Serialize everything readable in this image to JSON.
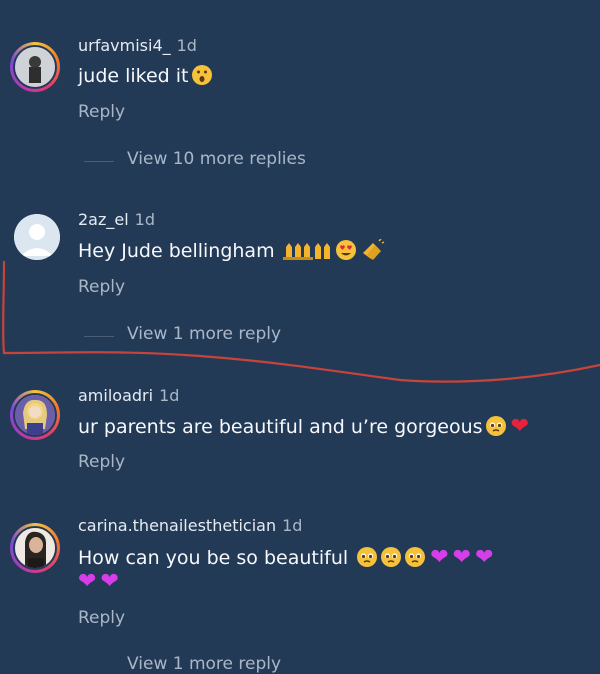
{
  "comments": [
    {
      "username": "urfavmisi4_",
      "time": "1d",
      "text": "jude liked it",
      "reply_label": "Reply",
      "view_replies": "View 10 more replies",
      "emojis": [
        "astonished-face"
      ]
    },
    {
      "username": "2az_el",
      "time": "1d",
      "text": "Hey Jude bellingham",
      "reply_label": "Reply",
      "view_replies": "View 1 more reply",
      "emojis": [
        "raising-hands",
        "raising-hands",
        "heart-eyes-face",
        "clapping-hands"
      ]
    },
    {
      "username": "amiloadri",
      "time": "1d",
      "text": "ur parents are beautiful and u’re gorgeous",
      "reply_label": "Reply",
      "emojis": [
        "pleading-face",
        "red-heart"
      ]
    },
    {
      "username": "carina.thenailesthetician",
      "time": "1d",
      "text": "How can you be so beautiful",
      "reply_label": "Reply",
      "view_replies": "View 1 more reply",
      "emojis": [
        "pleading-face",
        "pleading-face",
        "pleading-face",
        "purple-heart",
        "purple-heart",
        "purple-heart",
        "purple-heart",
        "purple-heart"
      ]
    }
  ],
  "colors": {
    "background": "#233a57",
    "annotation_line": "#c8443a",
    "purple_heart": "#d53ee8",
    "red_heart": "#e5243b"
  }
}
